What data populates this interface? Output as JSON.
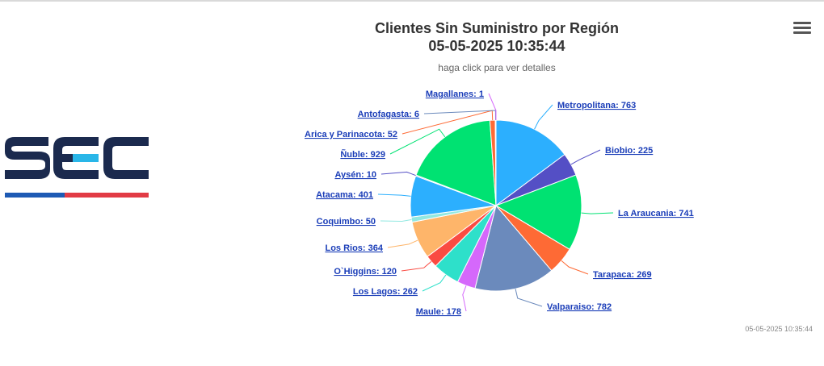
{
  "logo": {
    "text": "SEC"
  },
  "menu": {
    "icon": "hamburger-menu-icon"
  },
  "chart_data": {
    "type": "pie",
    "title_line1": "Clientes Sin Suministro por Región",
    "title_line2": "05-05-2025 10:35:44",
    "subtitle": "haga click para ver detalles",
    "credit": "05-05-2025 10:35:44",
    "slices": [
      {
        "name": "Metropolitana",
        "value": 763,
        "color": "#2caffe"
      },
      {
        "name": "Biobio",
        "value": 225,
        "color": "#544fc5"
      },
      {
        "name": "La Araucania",
        "value": 741,
        "color": "#00e272"
      },
      {
        "name": "Tarapaca",
        "value": 269,
        "color": "#fe6a35"
      },
      {
        "name": "Valparaiso",
        "value": 782,
        "color": "#6b8abc"
      },
      {
        "name": "Maule",
        "value": 178,
        "color": "#d568fb"
      },
      {
        "name": "Los Lagos",
        "value": 262,
        "color": "#2ee0ca"
      },
      {
        "name": "O`Higgins",
        "value": 120,
        "color": "#fa4b42"
      },
      {
        "name": "Los Rios",
        "value": 364,
        "color": "#feb56a"
      },
      {
        "name": "Coquimbo",
        "value": 50,
        "color": "#91e8e1"
      },
      {
        "name": "Atacama",
        "value": 401,
        "color": "#2caffe"
      },
      {
        "name": "Aysén",
        "value": 10,
        "color": "#544fc5"
      },
      {
        "name": "Ñuble",
        "value": 929,
        "color": "#00e272"
      },
      {
        "name": "Arica y Parinacota",
        "value": 52,
        "color": "#fe6a35"
      },
      {
        "name": "Antofagasta",
        "value": 6,
        "color": "#6b8abc"
      },
      {
        "name": "Magallanes",
        "value": 1,
        "color": "#d568fb"
      }
    ]
  }
}
